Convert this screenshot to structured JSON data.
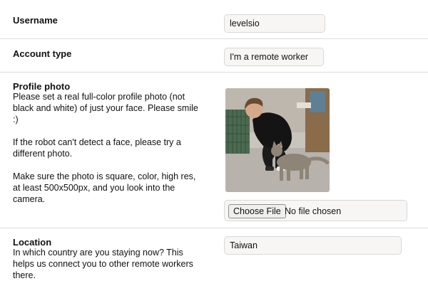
{
  "username": {
    "label": "Username",
    "value": "levelsio"
  },
  "account_type": {
    "label": "Account type",
    "value": "I'm a remote worker"
  },
  "profile_photo": {
    "label": "Profile photo",
    "description": "Please set a real full-color profile photo (not black and white) of just your face. Please smile :)\n\nIf the robot can't detect a face, please try a different photo.\n\nMake sure the photo is square, color, high res, at least 500x500px, and you look into the camera.",
    "image_subject": "man crouching next to a grey cat",
    "choose_file_label": "Choose File",
    "no_file_text": "No file chosen"
  },
  "location": {
    "label": "Location",
    "description": "In which country are you staying now? This helps us connect you to other remote workers there.",
    "value": "Taiwan"
  },
  "colors": {
    "divider": "#dcdcdc",
    "input_bg": "#f7f6f4",
    "input_border": "#d8d8d8"
  }
}
